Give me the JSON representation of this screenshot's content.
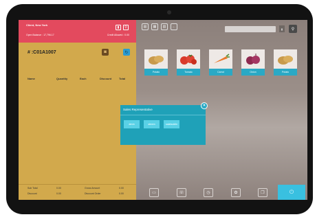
{
  "client": {
    "name": "Client, New York",
    "open_balance": "Open Balance : 17,796.17",
    "credit_allowed": "Credit Allowed : 0.00"
  },
  "order": {
    "number": "# :C01A1007",
    "columns": [
      "Name",
      "Quantity",
      "Each",
      "Discount",
      "Total"
    ]
  },
  "totals": {
    "sub_total_label": "Sub Total",
    "sub_total_value": "0.00",
    "discount_label": "Discount",
    "discount_value": "0.00",
    "gross_amount_label": "Gross Amount",
    "gross_amount_value": "0.00",
    "discount_order_label": "Discount Order",
    "discount_order_value": "0.00"
  },
  "search": {
    "placeholder": ""
  },
  "products": [
    {
      "label": "Potato",
      "icon": "potato-icon"
    },
    {
      "label": "Tomato",
      "icon": "tomato-icon"
    },
    {
      "label": "Carrot",
      "icon": "carrot-icon"
    },
    {
      "label": "Onion",
      "icon": "onion-icon"
    },
    {
      "label": "Potato",
      "icon": "potato-icon"
    }
  ],
  "modal": {
    "title": "Sales Representative",
    "reps": [
      "devin",
      "steven",
      "salahuddin"
    ]
  },
  "colors": {
    "client_bar": "#e34a5e",
    "order_panel": "#d2a94c",
    "accent": "#2aa9c5"
  }
}
